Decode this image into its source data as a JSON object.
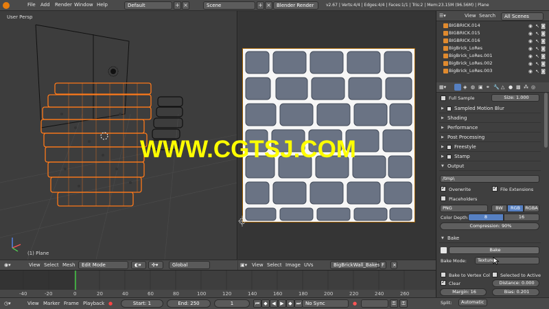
{
  "topbar": {
    "menus": [
      "File",
      "Add",
      "Render",
      "Window",
      "Help"
    ],
    "layout": "Default",
    "scene": "Scene",
    "engine": "Blender Render",
    "stats": "v2.67 | Verts:4/4 | Edges:4/4 | Faces:1/1 | Tris:2 | Mem:23.15M (96.56M) | Plane"
  },
  "viewport3d": {
    "view_label": "User Persp",
    "object_label": "(1) Plane"
  },
  "watermark": "WWW.CGTSJ.COM",
  "header3d": {
    "items": [
      "View",
      "Select",
      "Mesh"
    ],
    "mode": "Edit Mode",
    "orientation": "Global"
  },
  "header_img": {
    "items": [
      "View",
      "Select",
      "Image",
      "UVs"
    ],
    "image_name": "BigBrickWall_Bakes",
    "f_label": "F"
  },
  "timeline": {
    "ticks": [
      "-40",
      "-20",
      "0",
      "20",
      "40",
      "60",
      "80",
      "100",
      "120",
      "140",
      "160",
      "180",
      "200",
      "220",
      "240",
      "260"
    ],
    "menus": [
      "View",
      "Marker",
      "Frame",
      "Playback"
    ],
    "start": "Start: 1",
    "end": "End: 250",
    "current": "1",
    "sync": "No Sync"
  },
  "outliner": {
    "view": "View",
    "search": "Search",
    "scope": "All Scenes",
    "items": [
      "BIGBRICK.014",
      "BIGBRICK.015",
      "BIGBRICK.016",
      "BigBrick_LoRes",
      "BigBrick_LoRes.001",
      "BigBrick_LoRes.002",
      "BigBrick_LoRes.003"
    ]
  },
  "props": {
    "full_sample": "Full Sample",
    "size": "Size: 1.000",
    "sections_closed": [
      "Sampled Motion Blur",
      "Shading",
      "Performance",
      "Post Processing",
      "Freestyle",
      "Stamp"
    ],
    "output_title": "Output",
    "output_path": "/tmp\\",
    "overwrite": "Overwrite",
    "file_extensions": "File Extensions",
    "placeholders": "Placeholders",
    "format": "PNG",
    "bw": "BW",
    "rgb": "RGB",
    "rgba": "RGBA",
    "color_depth": "Color Depth:",
    "depth_8": "8",
    "depth_16": "16",
    "compression": "Compression: 90%",
    "bake_title": "Bake",
    "bake_button": "Bake",
    "bake_mode_label": "Bake Mode:",
    "bake_mode": "Textures",
    "bake_to_vertex": "Bake to Vertex Col",
    "selected_to_active": "Selected to Active",
    "clear": "Clear",
    "distance": "Distance: 0.000",
    "margin": "Margin: 16",
    "bias": "Bias: 0.201",
    "split_label": "Split:",
    "split_value": "Automatic"
  },
  "colors": {
    "selection_orange": "#ff7a1a",
    "active_blue": "#5680c2",
    "watermark_yellow": "#ffff00"
  }
}
